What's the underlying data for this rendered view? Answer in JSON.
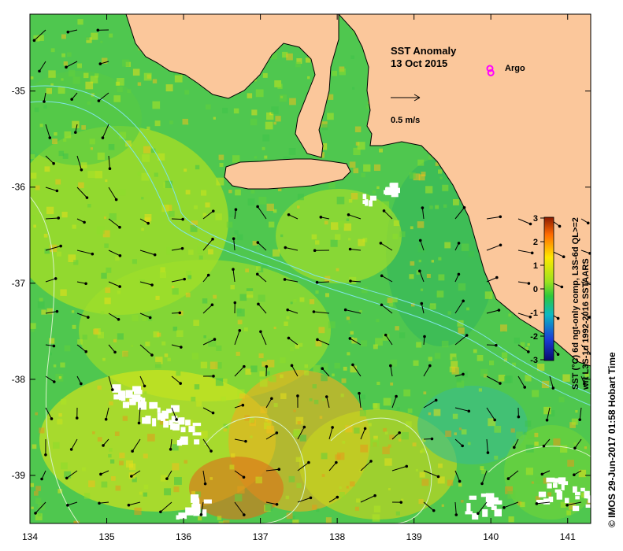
{
  "map": {
    "title": "SST Anomaly",
    "date": "13 Oct 2015",
    "argo_label": "Argo",
    "scale_label": "0.5 m/s",
    "credit": "© IMOS 29-Jun-2017 01:58 Hobart Time",
    "colorbar_caption_lines": [
      "SST (°C) 6d ngt-only comp, L3S-6d QL>=2",
      "wrt L3S-1d 1992-2016 SSTAARS"
    ],
    "colorbar_ticks": [
      "3",
      "2",
      "1",
      "0",
      "-1",
      "-2",
      "-3"
    ],
    "lon_ticks": [
      "134",
      "135",
      "136",
      "137",
      "138",
      "139",
      "140",
      "141"
    ],
    "lat_ticks": [
      "-35",
      "-36",
      "-37",
      "-38",
      "-39"
    ],
    "colors": {
      "land": "#fbc79b",
      "ocean_base": "#4fc74f",
      "no_data": "#ffffff",
      "argo": "#ff00ff"
    }
  },
  "chart_data": {
    "type": "heatmap",
    "title": "SST Anomaly",
    "subtitle": "13 Oct 2015",
    "xlabel": "",
    "ylabel": "",
    "xlim": [
      134,
      141.3
    ],
    "ylim": [
      -39.5,
      -34.2
    ],
    "x_ticks": [
      134,
      135,
      136,
      137,
      138,
      139,
      140,
      141
    ],
    "y_ticks": [
      -35,
      -36,
      -37,
      -38,
      -39
    ],
    "colorbar_range": [
      -3,
      3
    ],
    "argo_floats": [
      {
        "lon": 140.0,
        "lat": -34.81
      }
    ]
  }
}
